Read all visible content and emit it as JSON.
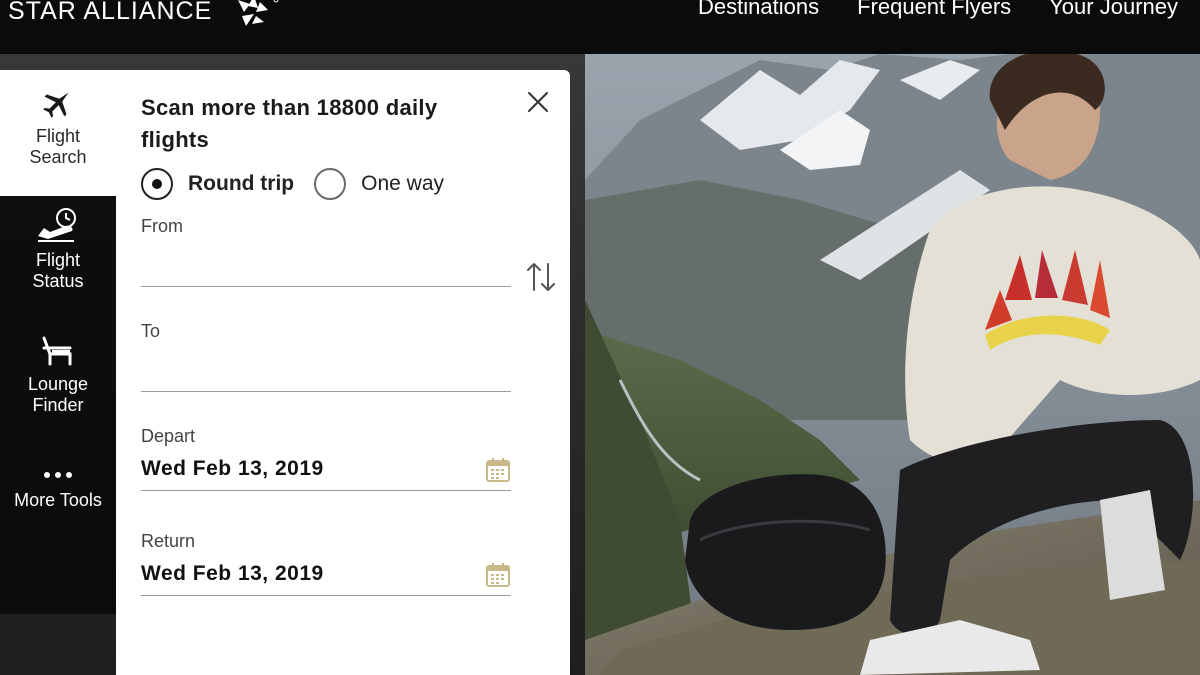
{
  "brand": {
    "name": "STAR ALLIANCE",
    "logo": "star-alliance-logo"
  },
  "nav": {
    "items": [
      {
        "label": "Destinations"
      },
      {
        "label": "Frequent Flyers"
      },
      {
        "label": "Your Journey"
      }
    ]
  },
  "rail": {
    "items": [
      {
        "label_line1": "Flight",
        "label_line2": "Search",
        "icon": "airplane-icon",
        "active": true
      },
      {
        "label_line1": "Flight",
        "label_line2": "Status",
        "icon": "flight-status-icon",
        "active": false
      },
      {
        "label_line1": "Lounge",
        "label_line2": "Finder",
        "icon": "lounge-chair-icon",
        "active": false
      },
      {
        "label_line1": "More Tools",
        "label_line2": "",
        "icon": "more-dots-icon",
        "active": false
      }
    ]
  },
  "search": {
    "title": "Scan more than 18800 daily flights",
    "close_icon": "close-icon",
    "trip_types": {
      "round_trip": "Round trip",
      "one_way": "One way",
      "selected": "Round trip"
    },
    "from": {
      "label": "From",
      "value": "",
      "placeholder": ""
    },
    "to": {
      "label": "To",
      "value": "",
      "placeholder": ""
    },
    "swap_icon": "swap-arrows-icon",
    "depart": {
      "label": "Depart",
      "value": "Wed Feb 13, 2019"
    },
    "return": {
      "label": "Return",
      "value": "Wed Feb 13, 2019"
    },
    "calendar_icon": "calendar-icon"
  },
  "colors": {
    "topbar": "#0b0b0b",
    "panel": "#ffffff",
    "text_dark": "#1a1a1a",
    "underline": "#9a9a9a",
    "calendar_icon": "#c9b98a"
  }
}
